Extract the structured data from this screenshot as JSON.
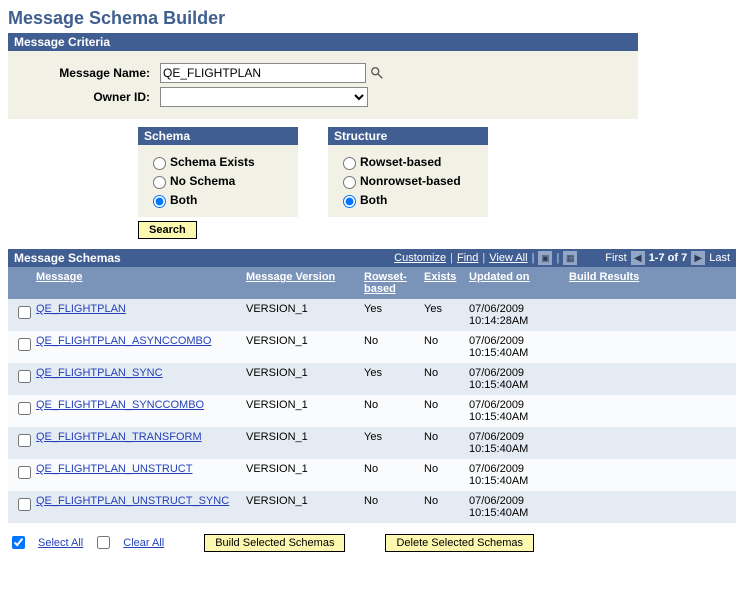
{
  "page_title": "Message Schema Builder",
  "criteria": {
    "header": "Message Criteria",
    "message_name_label": "Message Name:",
    "message_name_value": "QE_FLIGHTPLAN",
    "owner_id_label": "Owner ID:",
    "owner_id_value": ""
  },
  "schema_group": {
    "header": "Schema",
    "options": [
      "Schema Exists",
      "No Schema",
      "Both"
    ],
    "selected": 2
  },
  "structure_group": {
    "header": "Structure",
    "options": [
      "Rowset-based",
      "Nonrowset-based",
      "Both"
    ],
    "selected": 2
  },
  "search_label": "Search",
  "grid": {
    "title": "Message Schemas",
    "tools": {
      "customize": "Customize",
      "find": "Find",
      "view_all": "View All",
      "first": "First",
      "range": "1-7 of 7",
      "last": "Last"
    },
    "columns": [
      "",
      "Message",
      "Message Version",
      "Rowset-based",
      "Exists",
      "Updated on",
      "Build Results"
    ],
    "rows": [
      {
        "msg": "QE_FLIGHTPLAN",
        "ver": "VERSION_1",
        "rowset": "Yes",
        "exists": "Yes",
        "updated": "07/06/2009 10:14:28AM"
      },
      {
        "msg": "QE_FLIGHTPLAN_ASYNCCOMBO",
        "ver": "VERSION_1",
        "rowset": "No",
        "exists": "No",
        "updated": "07/06/2009 10:15:40AM"
      },
      {
        "msg": "QE_FLIGHTPLAN_SYNC",
        "ver": "VERSION_1",
        "rowset": "Yes",
        "exists": "No",
        "updated": "07/06/2009 10:15:40AM"
      },
      {
        "msg": "QE_FLIGHTPLAN_SYNCCOMBO",
        "ver": "VERSION_1",
        "rowset": "No",
        "exists": "No",
        "updated": "07/06/2009 10:15:40AM"
      },
      {
        "msg": "QE_FLIGHTPLAN_TRANSFORM",
        "ver": "VERSION_1",
        "rowset": "Yes",
        "exists": "No",
        "updated": "07/06/2009 10:15:40AM"
      },
      {
        "msg": "QE_FLIGHTPLAN_UNSTRUCT",
        "ver": "VERSION_1",
        "rowset": "No",
        "exists": "No",
        "updated": "07/06/2009 10:15:40AM"
      },
      {
        "msg": "QE_FLIGHTPLAN_UNSTRUCT_SYNC",
        "ver": "VERSION_1",
        "rowset": "No",
        "exists": "No",
        "updated": "07/06/2009 10:15:40AM"
      }
    ]
  },
  "actions": {
    "select_all": "Select All",
    "clear_all": "Clear All",
    "build": "Build Selected Schemas",
    "delete": "Delete Selected Schemas"
  }
}
